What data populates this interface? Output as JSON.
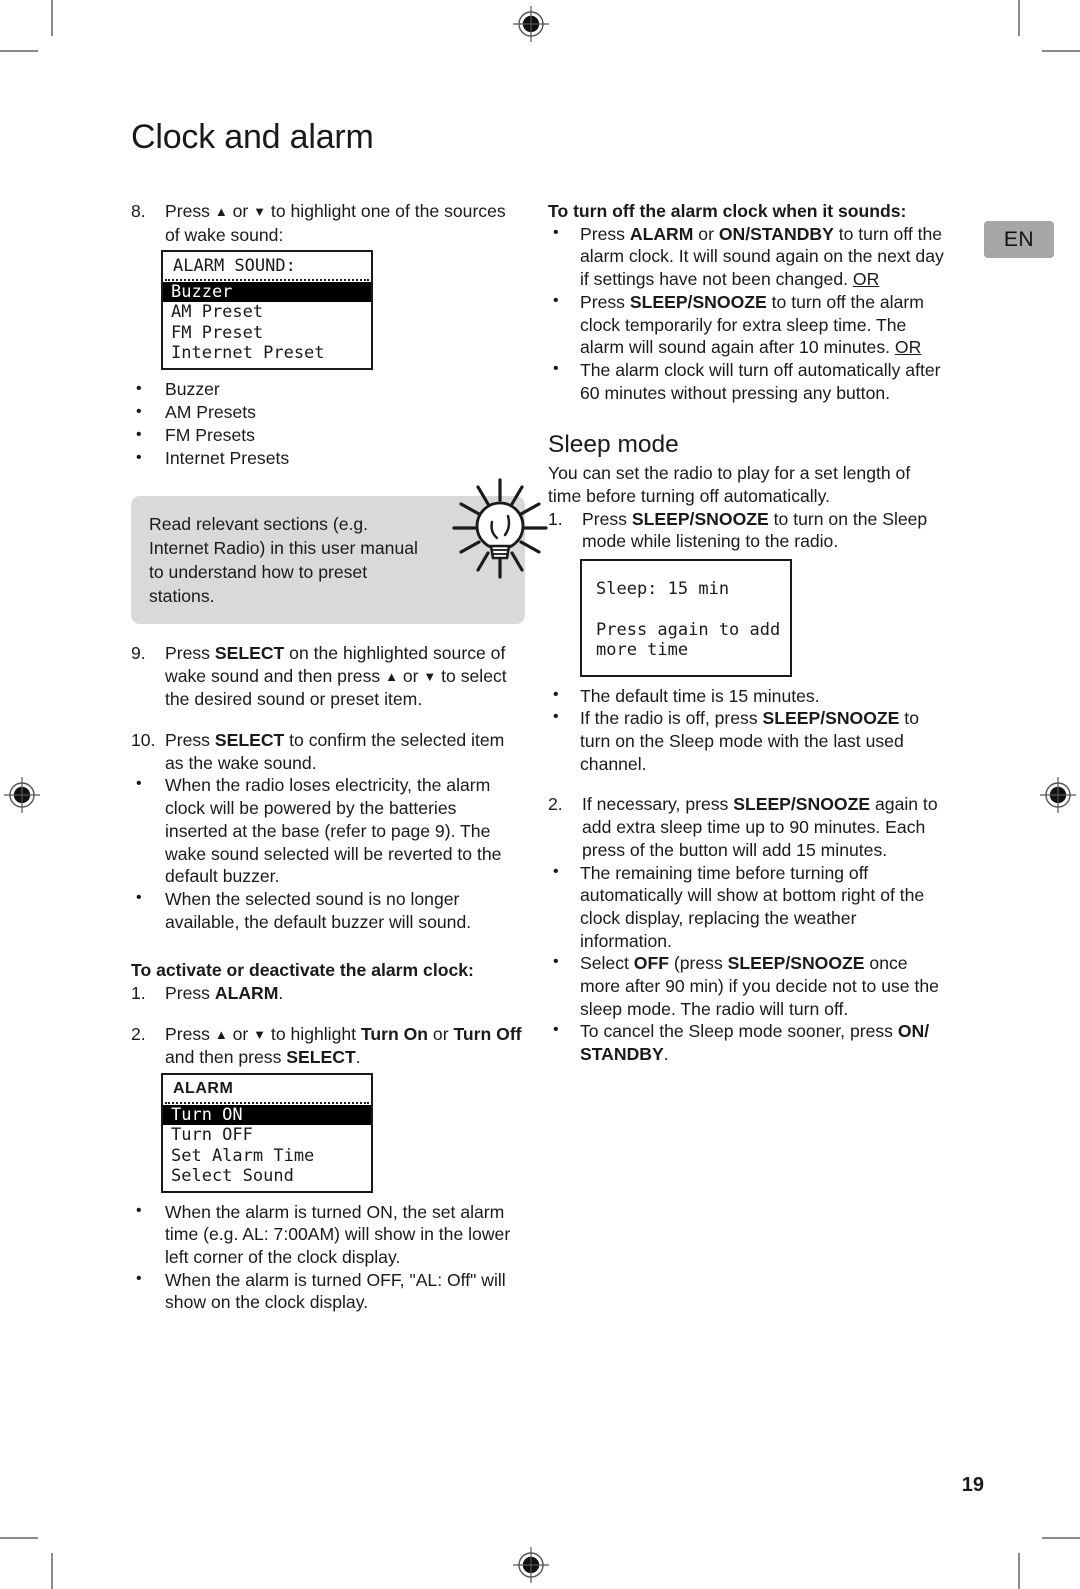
{
  "page": {
    "title": "Clock and alarm",
    "language_badge": "EN",
    "page_number": "19"
  },
  "left_column": {
    "step8": {
      "number": "8.",
      "text_before": "Press ",
      "arrow_up": "▲",
      "text_mid": " or ",
      "arrow_down": "▼",
      "text_after": " to highlight one of the sources of wake sound:"
    },
    "alarm_sound_lcd": {
      "title": "ALARM SOUND:",
      "rows": [
        {
          "label": "Buzzer",
          "selected": true
        },
        {
          "label": "AM Preset",
          "selected": false
        },
        {
          "label": "FM Preset",
          "selected": false
        },
        {
          "label": "Internet Preset",
          "selected": false
        }
      ]
    },
    "source_bullets": [
      "Buzzer",
      "AM Presets",
      "FM Presets",
      "Internet Presets"
    ],
    "tip": {
      "text": "Read relevant sections (e.g. Internet Radio) in this user manual to understand how to preset stations.",
      "icon": "lightbulb-icon"
    },
    "step9": {
      "number": "9.",
      "p1": "Press ",
      "b1": "SELECT",
      "p2": " on the highlighted source of wake sound and then press ",
      "arrow_up": "▲",
      "p3": " or ",
      "arrow_down": "▼",
      "p4": " to select the desired sound or preset item."
    },
    "step10": {
      "number": "10.",
      "p1": "Press ",
      "b1": "SELECT",
      "p2": " to confirm the selected item as the wake sound."
    },
    "step10_bullets": [
      "When the radio loses electricity, the alarm clock will be powered by the batteries inserted at the base (refer to page 9). The wake sound selected will be reverted to the default buzzer.",
      "When the selected sound is no longer available, the default buzzer will sound."
    ],
    "activate_heading": "To activate or deactivate the alarm clock:",
    "activate_step1": {
      "number": "1.",
      "p1": "Press ",
      "b1": "ALARM",
      "p2": "."
    },
    "activate_step2": {
      "number": "2.",
      "p1": "Press ",
      "arrow_up": "▲",
      "p2": " or ",
      "arrow_down": "▼",
      "p3": " to highlight ",
      "b1": "Turn On",
      "p4": " or ",
      "b2": "Turn Off",
      "p5": " and then press ",
      "b3": "SELECT",
      "p6": "."
    },
    "alarm_lcd": {
      "title": "ALARM",
      "rows": [
        {
          "label": "Turn ON",
          "selected": true
        },
        {
          "label": "Turn OFF",
          "selected": false
        },
        {
          "label": "Set Alarm Time",
          "selected": false
        },
        {
          "label": "Select Sound",
          "selected": false
        }
      ]
    },
    "alarm_bullets": [
      "When the alarm is turned ON, the set alarm time (e.g. AL: 7:00AM) will show in the lower left corner of the clock display.",
      "When the alarm is turned OFF, \"AL: Off\" will show on the clock display."
    ]
  },
  "right_column": {
    "turnoff_heading": "To turn off the alarm clock when it sounds:",
    "turnoff_b1": {
      "p1": "Press ",
      "b1": "ALARM",
      "p2": " or ",
      "b2": "ON/STANDBY",
      "p3": " to turn off the alarm clock. It will sound again on the next day if settings have not been changed."
    },
    "or_1": "OR",
    "turnoff_b2": {
      "p1": "Press ",
      "b1": "SLEEP/SNOOZE",
      "p2": " to turn off the alarm clock temporarily for extra sleep time. The alarm will sound again after 10 minutes."
    },
    "or_2": "OR",
    "turnoff_b3": "The alarm clock will turn off automatically after 60 minutes without pressing any button.",
    "sleep_heading": "Sleep mode",
    "sleep_intro": "You can set the radio to play for a set length of time before turning off automatically.",
    "sleep_step1": {
      "number": "1.",
      "p1": "Press ",
      "b1": "SLEEP/SNOOZE",
      "p2": " to turn on the Sleep mode while listening to the radio."
    },
    "sleep_lcd": {
      "line1": "Sleep: 15 min",
      "line2": "Press again to add",
      "line3": "more time"
    },
    "sleep_bullet1": "The default time is 15 minutes.",
    "sleep_bullet2": {
      "p1": "If the radio is off, press ",
      "b1": "SLEEP/SNOOZE",
      "p2": " to turn on the Sleep mode with the last used channel."
    },
    "sleep_step2": {
      "number": "2.",
      "p1": "If necessary, press ",
      "b1": "SLEEP/SNOOZE",
      "p2": " again to add extra sleep time up to 90 minutes. Each press of the button will add 15 minutes."
    },
    "sleep_bullet3": "The remaining time before turning off automatically will show at bottom right of the clock display, replacing the weather information.",
    "sleep_bullet4": {
      "p1": "Select ",
      "b1": "OFF",
      "p2": " (press ",
      "b2": "SLEEP/SNOOZE",
      "p3": " once more after 90 min) if you decide not to use the sleep mode. The radio will turn off."
    },
    "sleep_bullet5": {
      "p1": "To cancel the Sleep mode sooner, press ",
      "b1": "ON/ STANDBY",
      "p2": "."
    }
  },
  "bullet_char": "•",
  "colors": {
    "text": "#1a1a1a",
    "tip_background": "#d9d9d9",
    "badge_background": "#a6a6a6",
    "lcd_border": "#1a1a1a",
    "crop_mark": "#8a8a8a"
  }
}
